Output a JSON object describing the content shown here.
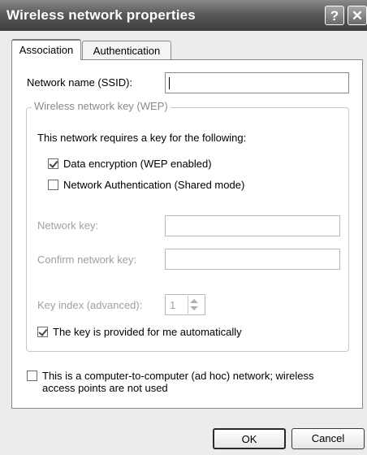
{
  "window": {
    "title": "Wireless network properties",
    "help_glyph": "?",
    "close_glyph": "✕"
  },
  "tabs": [
    {
      "label": "Association"
    },
    {
      "label": "Authentication"
    }
  ],
  "association": {
    "ssid_label": "Network name (SSID):",
    "ssid_value": "",
    "group_title": "Wireless network key (WEP)",
    "requires_text": "This network requires a key for the following:",
    "data_encryption": {
      "label": "Data encryption (WEP enabled)",
      "checked": true
    },
    "network_auth": {
      "label": "Network Authentication (Shared mode)",
      "checked": false
    },
    "network_key_label": "Network key:",
    "confirm_key_label": "Confirm network key:",
    "key_index_label": "Key index (advanced):",
    "key_index_value": "1",
    "auto_key": {
      "label": "The key is provided for me automatically",
      "checked": true
    },
    "adhoc": {
      "label_line1": "This is a computer-to-computer (ad hoc) network; wireless",
      "label_line2": "access points are not used",
      "checked": false
    }
  },
  "buttons": {
    "ok": "OK",
    "cancel": "Cancel"
  }
}
